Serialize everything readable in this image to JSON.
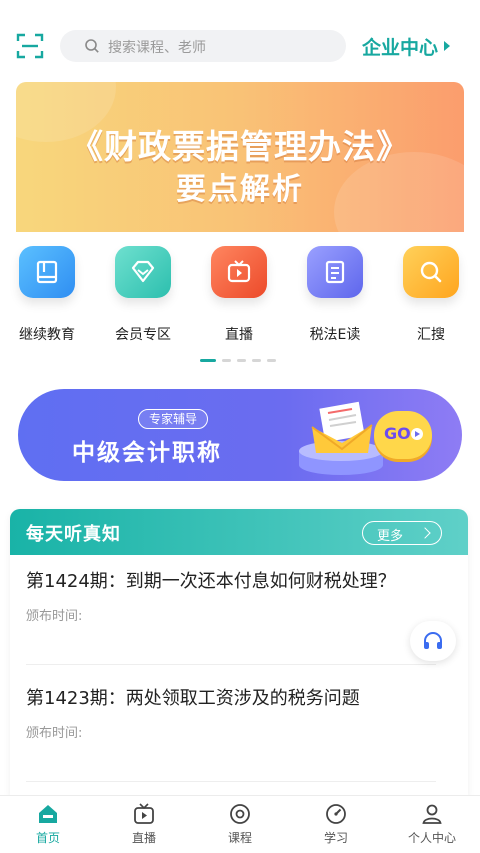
{
  "header": {
    "search_placeholder": "搜索课程、老师",
    "enterprise_label": "企业中心"
  },
  "banner": {
    "line1": "《财政票据管理办法》",
    "line2": "要点解析"
  },
  "quick_menu": {
    "items": [
      {
        "label": "继续教育",
        "icon": "book-icon",
        "color": "#3aa0f5"
      },
      {
        "label": "会员专区",
        "icon": "diamond-icon",
        "color": "#3cc8b5"
      },
      {
        "label": "直播",
        "icon": "tv-icon",
        "color": "#f25b3a"
      },
      {
        "label": "税法E读",
        "icon": "document-icon",
        "color": "#6f76f2"
      },
      {
        "label": "汇搜",
        "icon": "search-icon",
        "color": "#ffb42c"
      }
    ],
    "page_count": 5,
    "active_page": 0
  },
  "promo": {
    "tag": "专家辅导",
    "title": "中级会计职称",
    "go_label": "GO"
  },
  "daily": {
    "title": "每天听真知",
    "more_label": "更多",
    "articles": [
      {
        "title": "第1424期：到期一次还本付息如何财税处理？",
        "date_label": "颁布时间:"
      },
      {
        "title": "第1423期：两处领取工资涉及的税务问题",
        "date_label": "颁布时间:"
      }
    ]
  },
  "bottom_nav": {
    "items": [
      {
        "label": "首页",
        "icon": "home-icon",
        "active": true
      },
      {
        "label": "直播",
        "icon": "tv-icon",
        "active": false
      },
      {
        "label": "课程",
        "icon": "course-icon",
        "active": false
      },
      {
        "label": "学习",
        "icon": "study-icon",
        "active": false
      },
      {
        "label": "个人中心",
        "icon": "user-icon",
        "active": false
      }
    ]
  },
  "colors": {
    "accent": "#17a8a0",
    "banner_gradient": [
      "#f8d77c",
      "#fb9d6d"
    ],
    "promo_gradient": [
      "#5f6ff2",
      "#8e7cf4"
    ]
  }
}
